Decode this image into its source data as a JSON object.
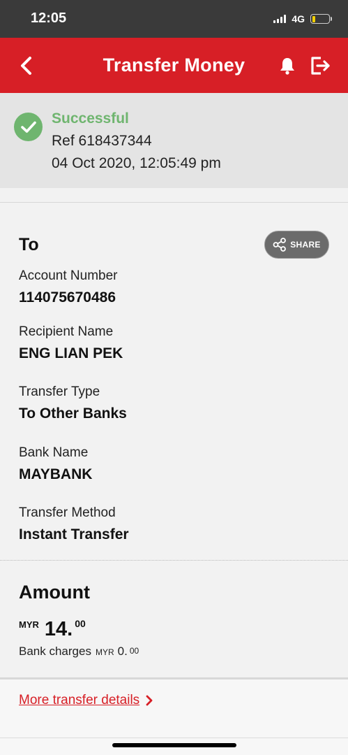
{
  "status_bar": {
    "time": "12:05",
    "network": "4G",
    "battery_level": 0.2,
    "battery_color": "#f4d000"
  },
  "header": {
    "title": "Transfer Money",
    "background_color": "#d71f26",
    "back_icon": "chevron-left-icon",
    "bell_icon": "bell-icon",
    "logout_icon": "logout-icon"
  },
  "result": {
    "status": "Successful",
    "status_color": "#6fb56f",
    "reference": "Ref 618437344",
    "datetime": "04 Oct 2020, 12:05:49 pm",
    "icon": "check-circle-icon"
  },
  "recipient": {
    "heading": "To",
    "share_label": "SHARE",
    "share_icon": "share-icon",
    "fields": [
      {
        "label": "Account Number",
        "value": "114075670486"
      },
      {
        "label": "Recipient Name",
        "value": "ENG LIAN PEK"
      },
      {
        "label": "Transfer Type",
        "value": "To Other Banks"
      },
      {
        "label": "Bank Name",
        "value": "MAYBANK"
      },
      {
        "label": "Transfer Method",
        "value": "Instant Transfer"
      }
    ]
  },
  "amount": {
    "heading": "Amount",
    "currency": "MYR",
    "whole": "14.",
    "cents": "00",
    "charges_label": "Bank charges",
    "charges_currency": "MYR",
    "charges_whole": "0.",
    "charges_cents": "00"
  },
  "footer": {
    "more_link": "More transfer details",
    "more_icon": "chevron-right-icon"
  }
}
